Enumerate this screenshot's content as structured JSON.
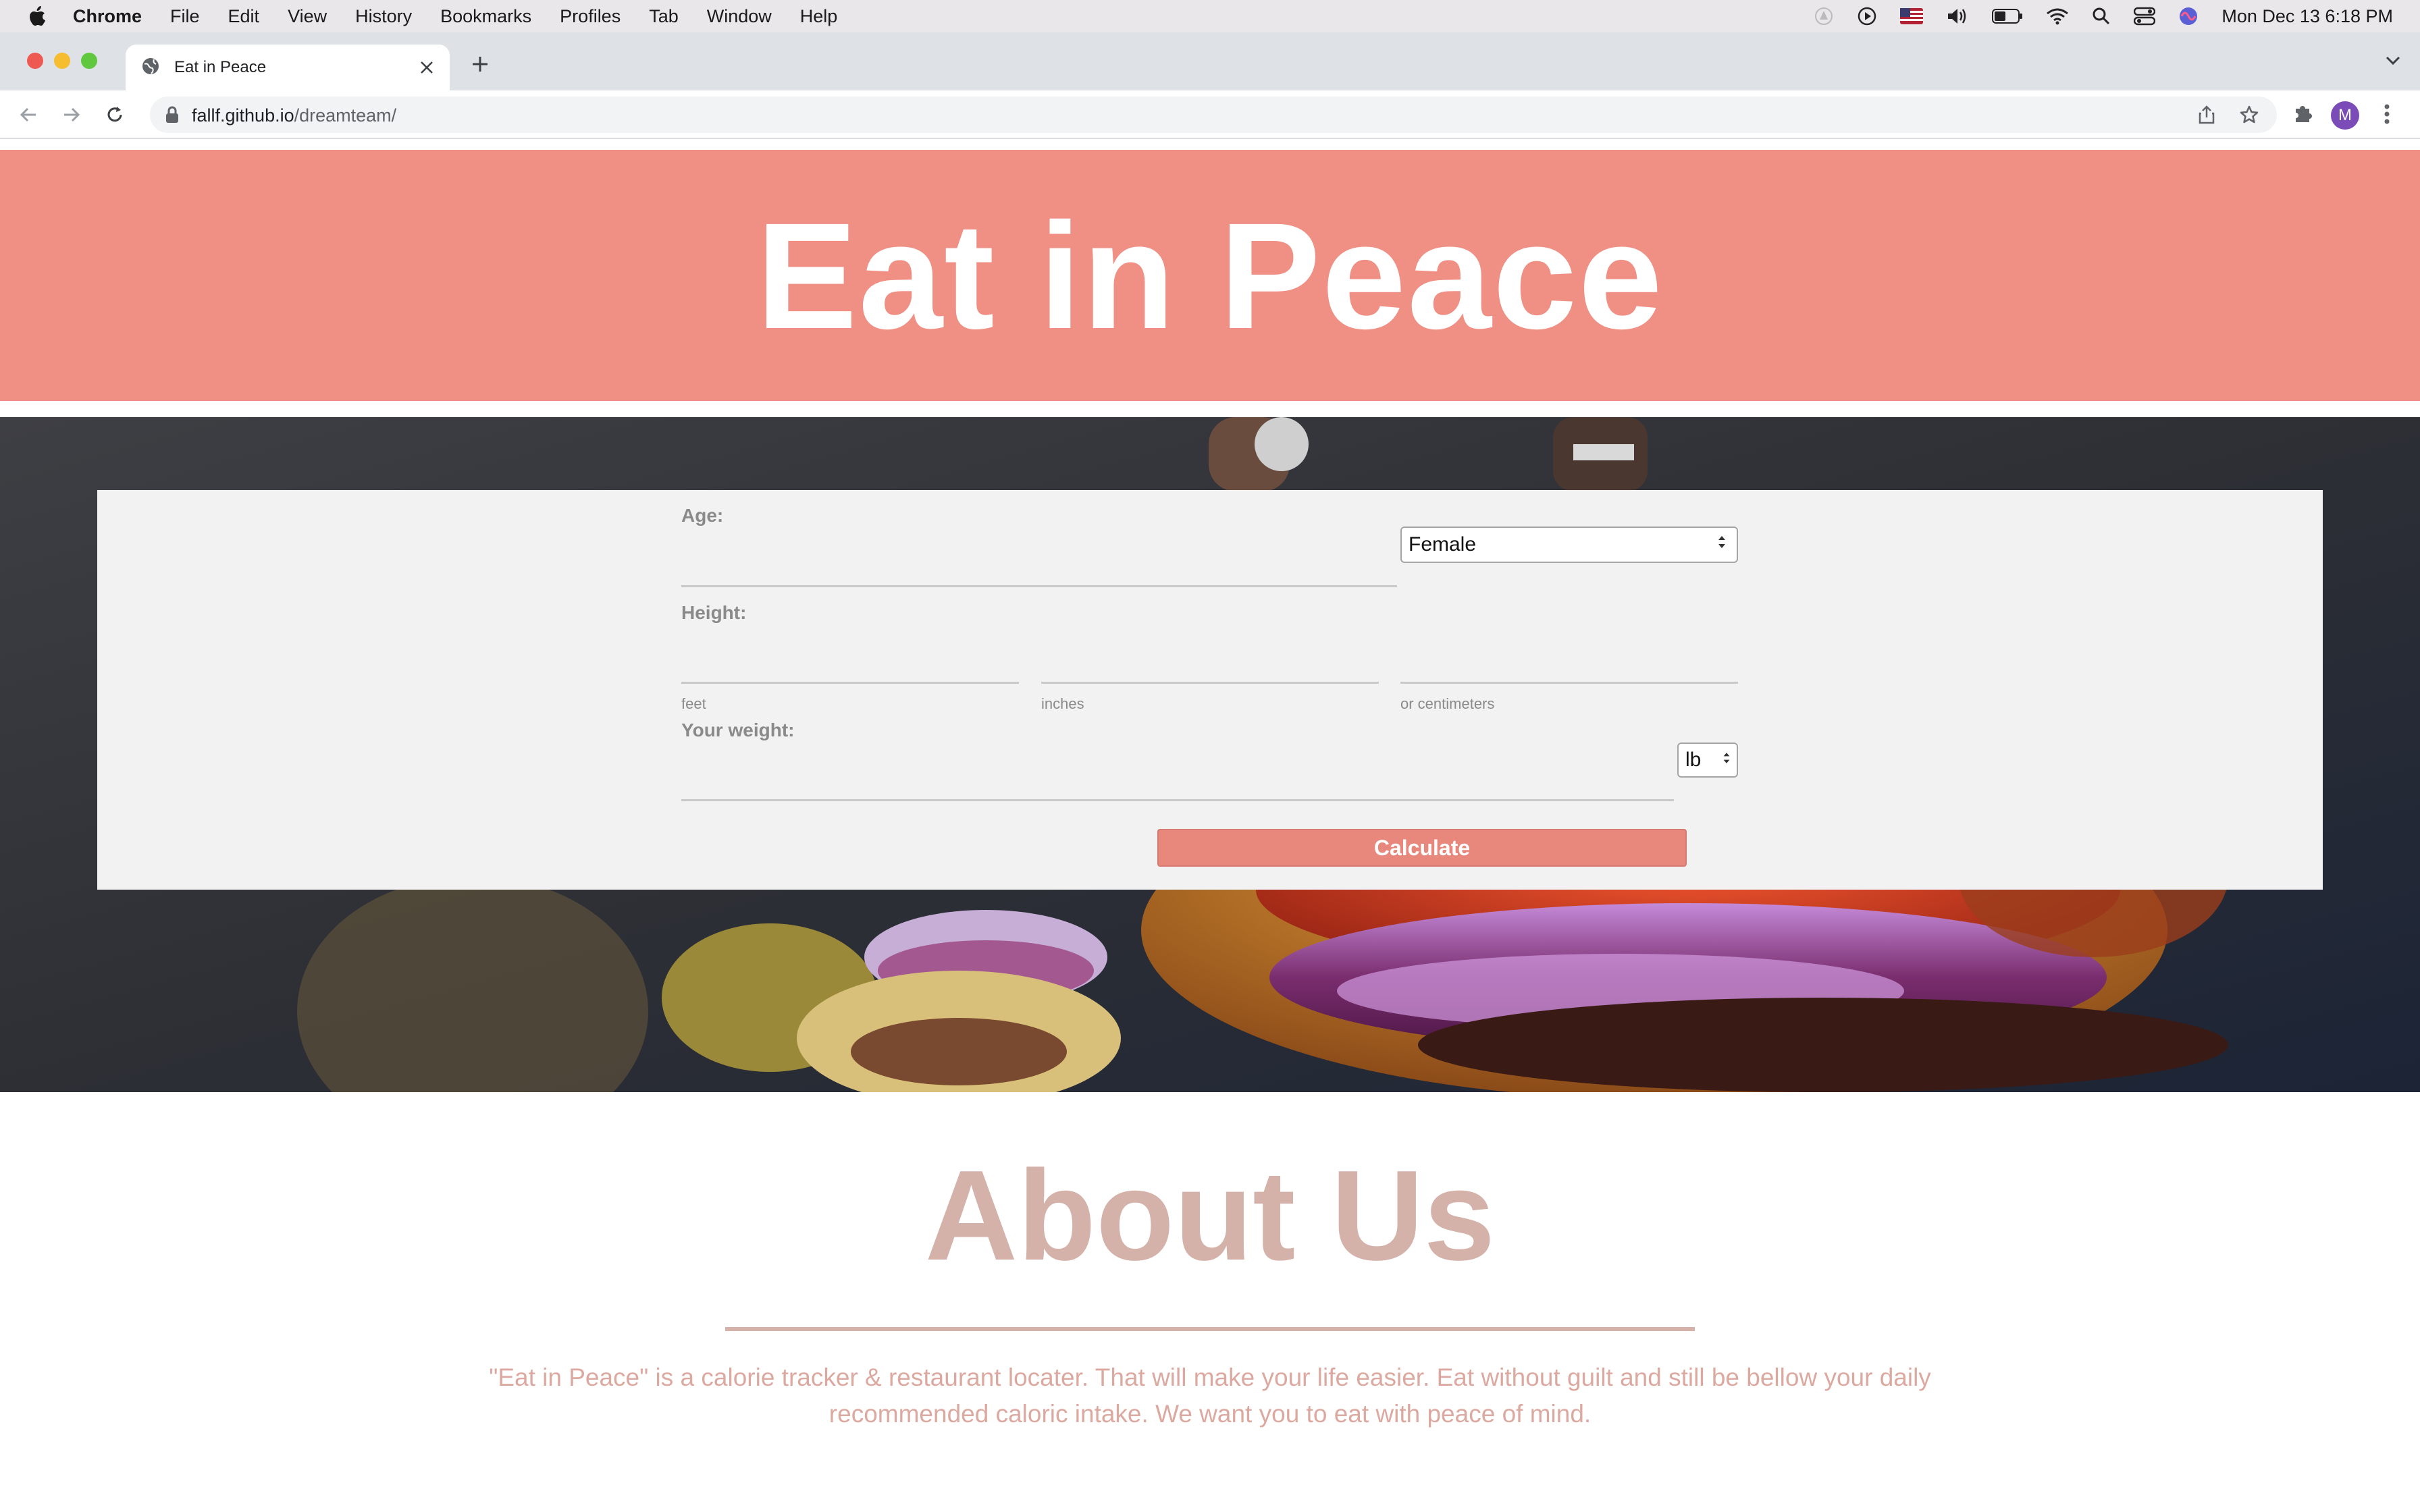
{
  "menubar": {
    "app": "Chrome",
    "items": [
      "File",
      "Edit",
      "View",
      "History",
      "Bookmarks",
      "Profiles",
      "Tab",
      "Window",
      "Help"
    ],
    "clock": "Mon Dec 13  6:18 PM"
  },
  "browser": {
    "tab_title": "Eat in Peace",
    "url_host": "fallf.github.io",
    "url_path": "/dreamteam/",
    "profile_initial": "M"
  },
  "hero": {
    "title": "Eat in Peace",
    "background": "#f08f84"
  },
  "form": {
    "age_label": "Age:",
    "age_value": "",
    "sex_selected": "Female",
    "height_label": "Height:",
    "feet_value": "",
    "inches_value": "",
    "cm_value": "",
    "feet_label": "feet",
    "inches_label": "inches",
    "cm_label": "or centimeters",
    "weight_label": "Your weight:",
    "weight_value": "",
    "weight_unit_selected": "lb",
    "calculate_label": "Calculate",
    "button_color": "#e8877c"
  },
  "about": {
    "title": "About Us",
    "text": "\"Eat in Peace\" is a calorie tracker & restaurant locater. That will make your life easier. Eat without guilt and still be bellow your daily recommended caloric intake. We want you to eat with peace of mind.",
    "accent": "#d4b2aa"
  }
}
